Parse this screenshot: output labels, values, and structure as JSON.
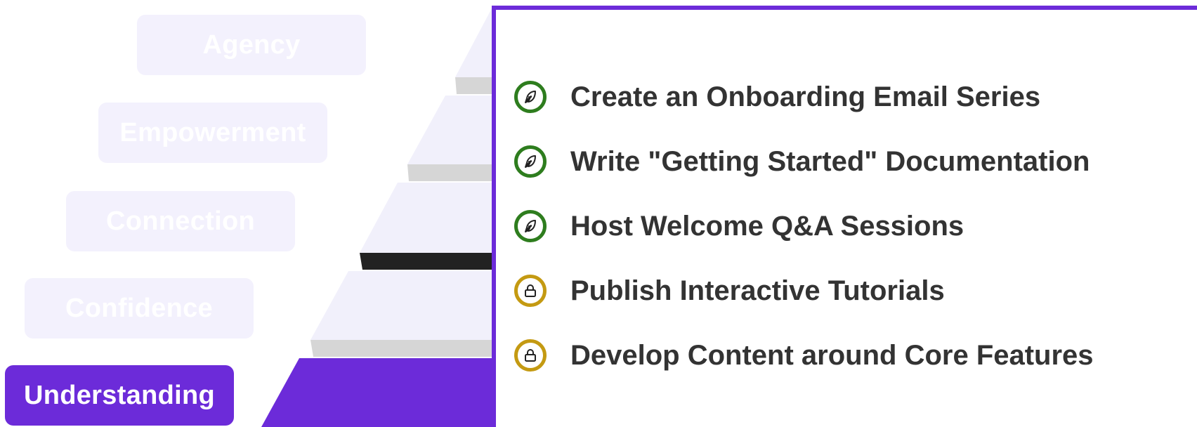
{
  "stages": [
    {
      "label": "Agency",
      "active": false
    },
    {
      "label": "Empowerment",
      "active": false
    },
    {
      "label": "Connection",
      "active": false
    },
    {
      "label": "Confidence",
      "active": false
    },
    {
      "label": "Understanding",
      "active": true
    }
  ],
  "tasks": [
    {
      "label": "Create an Onboarding Email Series",
      "status": "complete",
      "icon": "feather-icon"
    },
    {
      "label": "Write \"Getting Started\" Documentation",
      "status": "complete",
      "icon": "feather-icon"
    },
    {
      "label": "Host Welcome Q&A Sessions",
      "status": "complete",
      "icon": "feather-icon"
    },
    {
      "label": "Publish Interactive Tutorials",
      "status": "locked",
      "icon": "lock-icon"
    },
    {
      "label": "Develop Content around Core Features",
      "status": "locked",
      "icon": "lock-icon"
    }
  ],
  "colors": {
    "accent": "#6c2bd9",
    "complete": "#2e7d1e",
    "locked": "#c49a12",
    "inactive_stage": "#f3f1fd",
    "text": "#333333"
  }
}
